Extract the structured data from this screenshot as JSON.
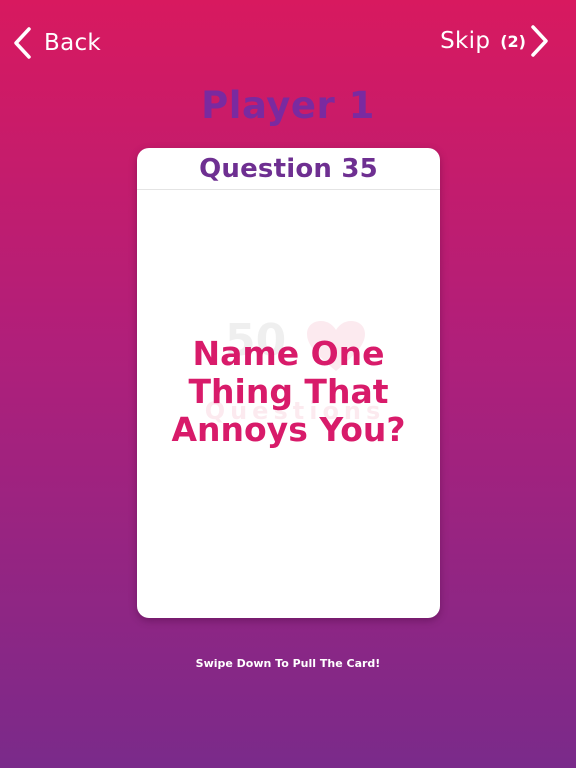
{
  "nav": {
    "back_label": "Back",
    "skip_label": "Skip",
    "skip_count": "(2)"
  },
  "player": {
    "name": "Player 1"
  },
  "card": {
    "question_number": "Question 35",
    "question_text": "Name One Thing That Annoys You?",
    "watermark": {
      "number": "50",
      "subtitle": "Questions"
    }
  },
  "hint": "Swipe Down To Pull The Card!",
  "colors": {
    "gradient_top": "#d8195f",
    "gradient_bottom": "#7a2a8a",
    "player_name": "#7a2aa0",
    "question_number": "#6e2f91",
    "question_text": "#d81b6a"
  },
  "icons": {
    "back": "chevron-left-icon",
    "skip": "chevron-right-icon",
    "watermark_heart": "heart-icon"
  }
}
